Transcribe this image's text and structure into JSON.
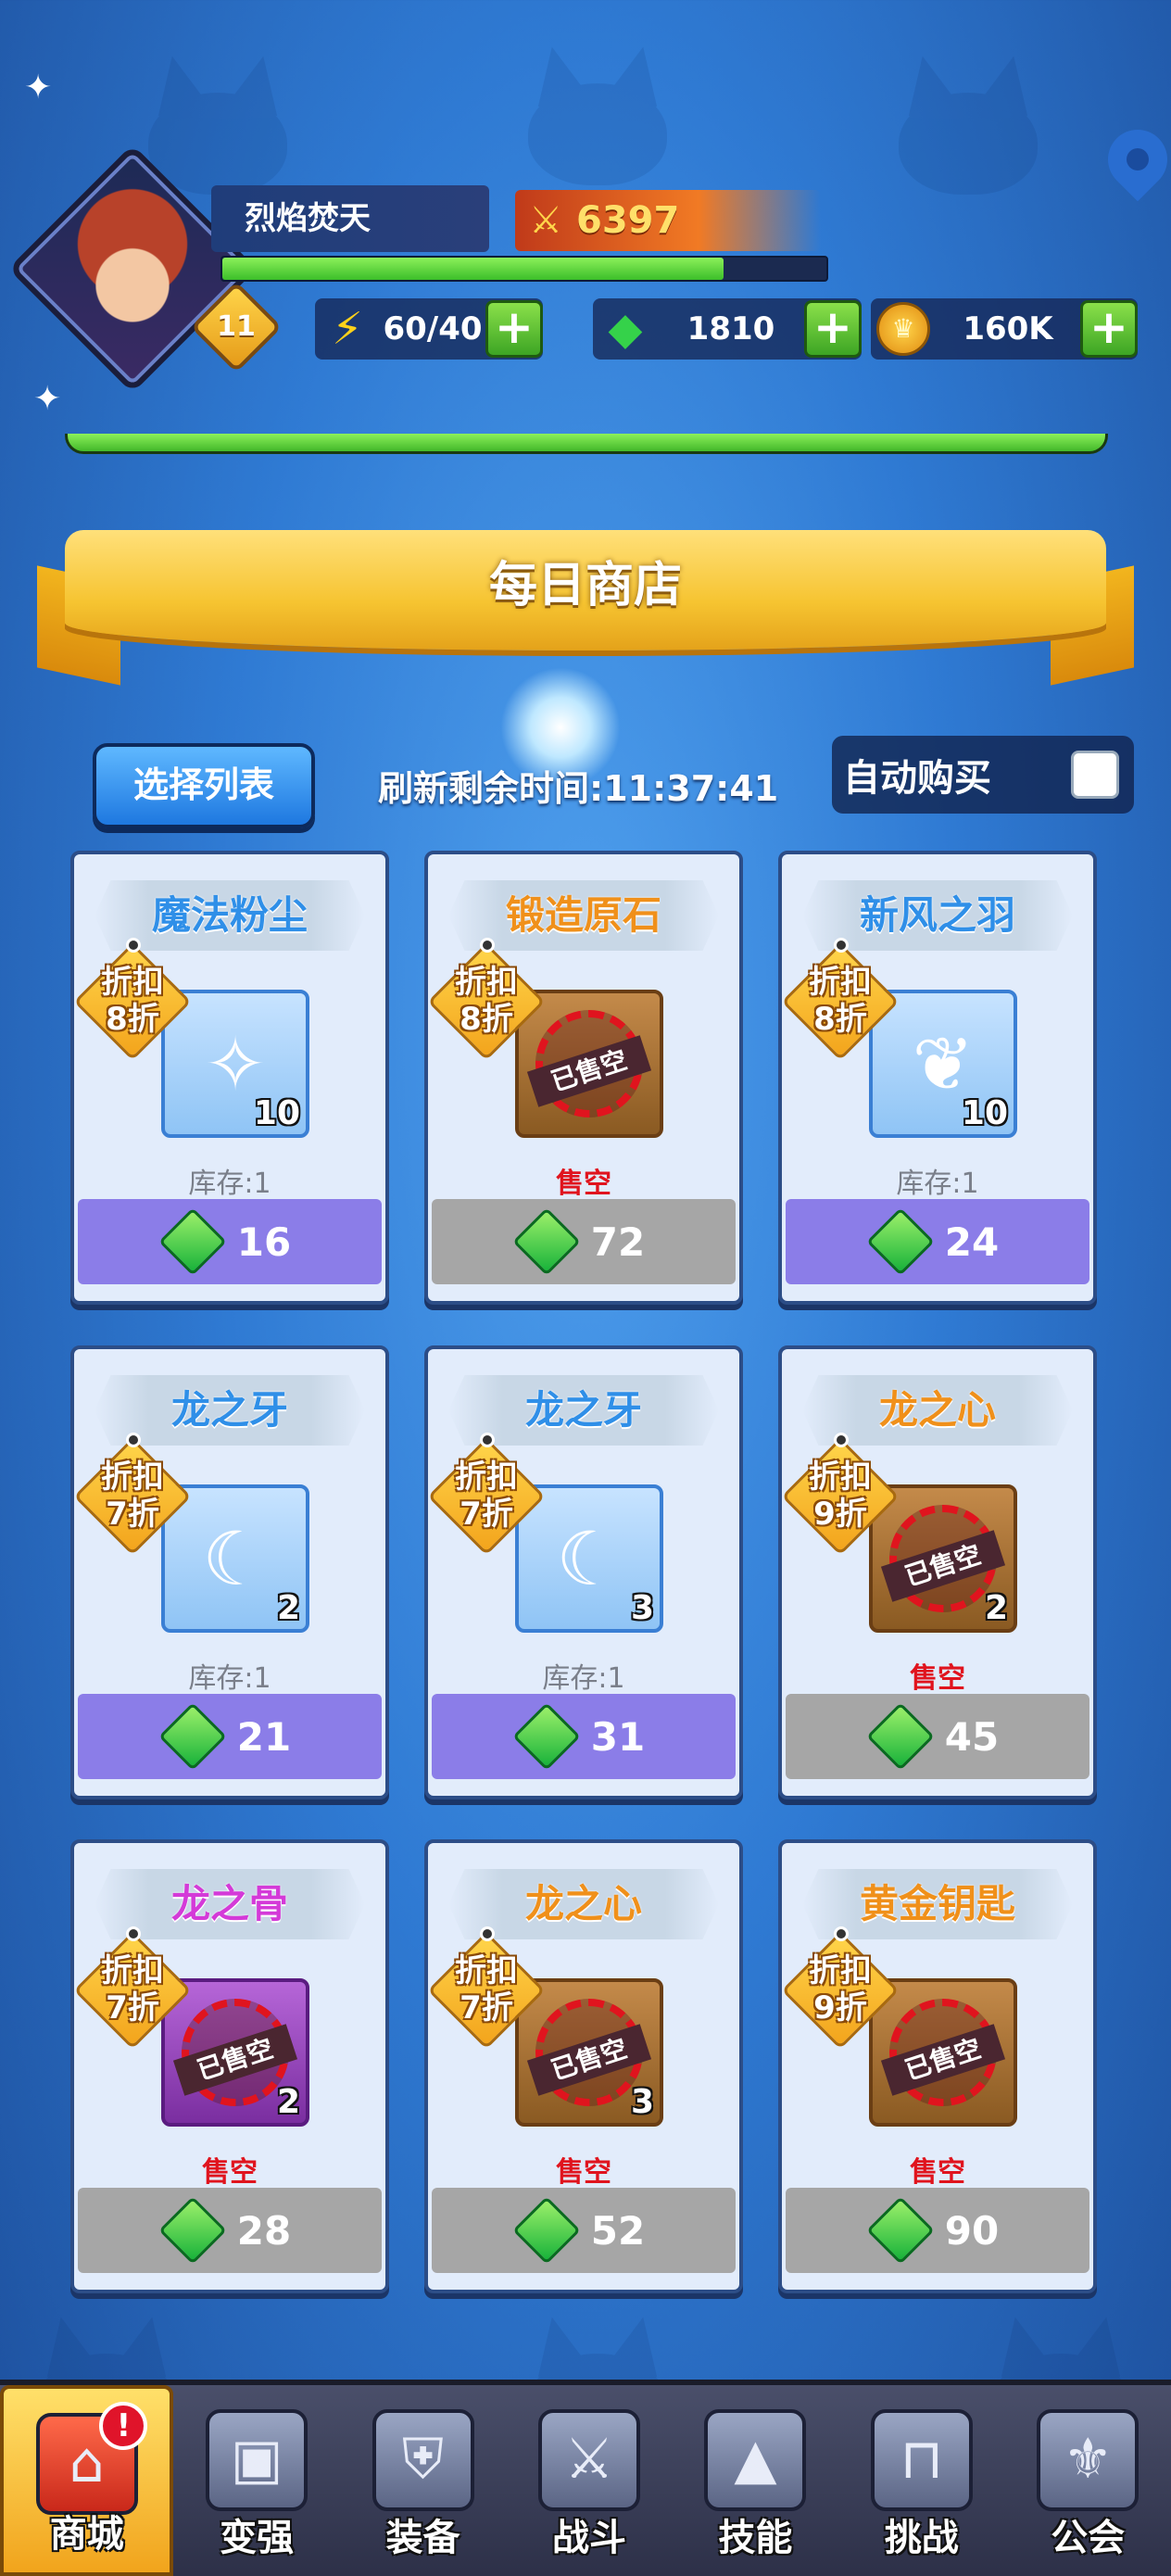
{
  "player": {
    "name": "烈焰焚天",
    "level": "11",
    "power": "6397",
    "xp_progress": 0.83
  },
  "resources": {
    "energy": "60/40",
    "gems": "1810",
    "gold": "160K"
  },
  "shop": {
    "title": "每日商店",
    "select_list_label": "选择列表",
    "refresh_text": "刷新剩余时间:11:37:41",
    "auto_buy_label": "自动购买",
    "auto_buy_checked": false
  },
  "items": [
    {
      "name": "魔法粉尘",
      "name_color": "blue",
      "discount_line1": "折扣",
      "discount_line2": "8折",
      "frame": "blue",
      "icon": "dust-icon",
      "count": "10",
      "sold_out": false,
      "stock_text": "库存:1",
      "price": "16"
    },
    {
      "name": "锻造原石",
      "name_color": "orange",
      "discount_line1": "折扣",
      "discount_line2": "8折",
      "frame": "brown",
      "icon": "ore-icon",
      "count": "",
      "sold_out": true,
      "stamp_text": "已售空",
      "stock_text": "售空",
      "price": "72"
    },
    {
      "name": "新风之羽",
      "name_color": "blue",
      "discount_line1": "折扣",
      "discount_line2": "8折",
      "frame": "blue",
      "icon": "feather-icon",
      "count": "10",
      "sold_out": false,
      "stock_text": "库存:1",
      "price": "24"
    },
    {
      "name": "龙之牙",
      "name_color": "blue",
      "discount_line1": "折扣",
      "discount_line2": "7折",
      "frame": "blue",
      "icon": "fang-icon",
      "count": "2",
      "sold_out": false,
      "stock_text": "库存:1",
      "price": "21"
    },
    {
      "name": "龙之牙",
      "name_color": "blue",
      "discount_line1": "折扣",
      "discount_line2": "7折",
      "frame": "blue",
      "icon": "fang-icon",
      "count": "3",
      "sold_out": false,
      "stock_text": "库存:1",
      "price": "31"
    },
    {
      "name": "龙之心",
      "name_color": "orange",
      "discount_line1": "折扣",
      "discount_line2": "9折",
      "frame": "brown",
      "icon": "heart-icon",
      "count": "2",
      "sold_out": true,
      "stamp_text": "已售空",
      "stock_text": "售空",
      "price": "45"
    },
    {
      "name": "龙之骨",
      "name_color": "pink",
      "discount_line1": "折扣",
      "discount_line2": "7折",
      "frame": "purple",
      "icon": "bone-icon",
      "count": "2",
      "sold_out": true,
      "stamp_text": "已售空",
      "stock_text": "售空",
      "price": "28"
    },
    {
      "name": "龙之心",
      "name_color": "orange",
      "discount_line1": "折扣",
      "discount_line2": "7折",
      "frame": "brown",
      "icon": "heart-icon",
      "count": "3",
      "sold_out": true,
      "stamp_text": "已售空",
      "stock_text": "售空",
      "price": "52"
    },
    {
      "name": "黄金钥匙",
      "name_color": "orange",
      "discount_line1": "折扣",
      "discount_line2": "9折",
      "frame": "brown",
      "icon": "key-icon",
      "count": "",
      "sold_out": true,
      "stamp_text": "已售空",
      "stock_text": "售空",
      "price": "90"
    }
  ],
  "nav": [
    {
      "label": "商城",
      "icon": "shop-icon",
      "active": true,
      "alert": "!"
    },
    {
      "label": "变强",
      "icon": "chest-icon",
      "active": false
    },
    {
      "label": "装备",
      "icon": "armor-icon",
      "active": false
    },
    {
      "label": "战斗",
      "icon": "swords-icon",
      "active": false
    },
    {
      "label": "技能",
      "icon": "skillbook-icon",
      "active": false
    },
    {
      "label": "挑战",
      "icon": "gate-icon",
      "active": false
    },
    {
      "label": "公会",
      "icon": "guild-shield-icon",
      "active": false
    }
  ],
  "colors": {
    "price_available": "#8b7de8",
    "price_soldout": "#a6a6a6",
    "sold_out_text": "#e0141e",
    "xp_bar": "#42b82a"
  }
}
